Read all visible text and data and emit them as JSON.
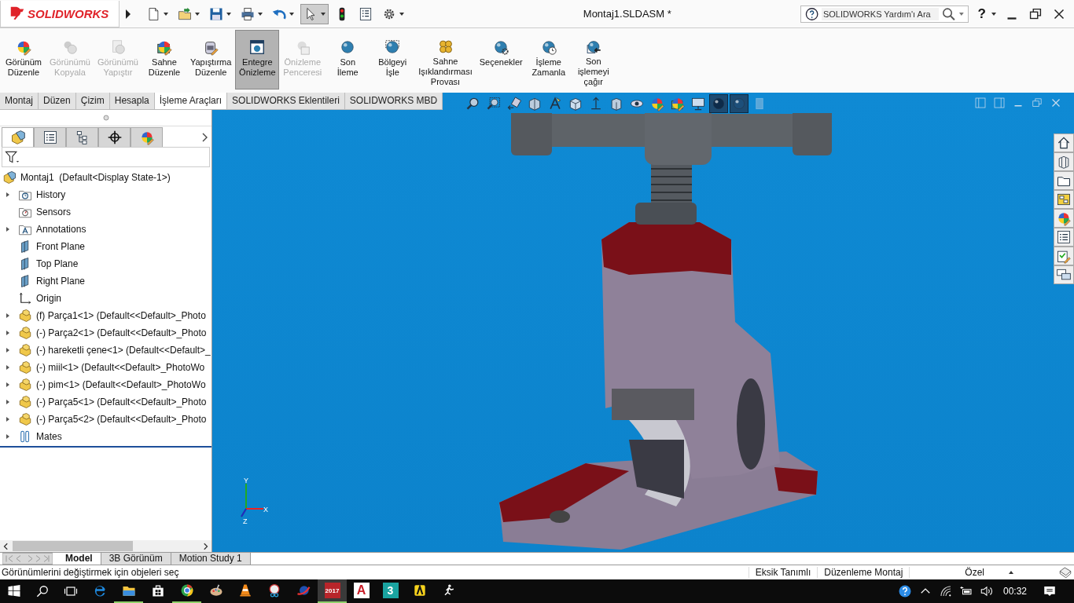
{
  "app": {
    "logo": "SOLIDWORKS",
    "title": "Montaj1.SLDASM *",
    "search_placeholder": "SOLIDWORKS Yardım'ı Ara",
    "help": "?"
  },
  "quick_access": [
    {
      "kind": "new",
      "dropdown": true,
      "selected": false
    },
    {
      "kind": "open",
      "dropdown": true,
      "selected": false
    },
    {
      "kind": "save",
      "dropdown": true,
      "selected": false
    },
    {
      "kind": "print",
      "dropdown": true,
      "selected": false
    },
    {
      "kind": "undo",
      "dropdown": true,
      "selected": false
    },
    {
      "kind": "select",
      "dropdown": true,
      "selected": true
    },
    {
      "kind": "rebuild",
      "dropdown": false,
      "selected": false
    },
    {
      "kind": "props",
      "dropdown": false,
      "selected": false
    },
    {
      "kind": "gear",
      "dropdown": true,
      "selected": false
    }
  ],
  "ribbon": [
    {
      "kind": "appearance",
      "label": "Görünüm\nDüzenle",
      "disabled": false,
      "selected": false
    },
    {
      "kind": "copy",
      "label": "Görünümü\nKopyala",
      "disabled": true,
      "selected": false
    },
    {
      "kind": "paste",
      "label": "Görünümü\nYapıştır",
      "disabled": true,
      "selected": false
    },
    {
      "kind": "scene",
      "label": "Sahne\nDüzenle",
      "disabled": false,
      "selected": false
    },
    {
      "kind": "decal",
      "label": "Yapıştırma\nDüzenle",
      "disabled": false,
      "selected": false
    },
    {
      "kind": "preview",
      "label": "Entegre\nÖnizleme",
      "disabled": false,
      "selected": true
    },
    {
      "kind": "window",
      "label": "Önizleme\nPenceresi",
      "disabled": true,
      "selected": false
    },
    {
      "kind": "render",
      "label": "Son\nİleme",
      "disabled": false,
      "selected": false
    },
    {
      "kind": "region",
      "label": "Bölgeyi\nİşle",
      "disabled": false,
      "selected": false
    },
    {
      "kind": "lights",
      "label": "Sahne\nIşıklandırması\nProvası",
      "disabled": false,
      "selected": false
    },
    {
      "kind": "options",
      "label": "Seçenekler",
      "disabled": false,
      "selected": false
    },
    {
      "kind": "schedule",
      "label": "İşleme\nZamanla",
      "disabled": false,
      "selected": false
    },
    {
      "kind": "recall",
      "label": "Son\nişlemeyi\nçağır",
      "disabled": false,
      "selected": false
    }
  ],
  "command_tabs": [
    {
      "label": "Montaj",
      "selected": false
    },
    {
      "label": "Düzen",
      "selected": false
    },
    {
      "label": "Çizim",
      "selected": false
    },
    {
      "label": "Hesapla",
      "selected": false
    },
    {
      "label": "İşleme Araçları",
      "selected": true
    },
    {
      "label": "SOLIDWORKS Eklentileri",
      "selected": false
    },
    {
      "label": "SOLIDWORKS MBD",
      "selected": false
    }
  ],
  "heads_up": [
    {
      "kind": "zoomfit",
      "selected": false
    },
    {
      "kind": "zoomarea",
      "selected": false
    },
    {
      "kind": "prev",
      "selected": false
    },
    {
      "kind": "section",
      "selected": false
    },
    {
      "kind": "annot",
      "selected": false
    },
    {
      "kind": "cube",
      "selected": false
    },
    {
      "kind": "updown",
      "selected": false
    },
    {
      "kind": "box",
      "selected": false
    },
    {
      "kind": "eye",
      "selected": false
    },
    {
      "kind": "appearance",
      "selected": false
    },
    {
      "kind": "scene",
      "selected": false
    },
    {
      "kind": "monitor",
      "selected": false
    },
    {
      "kind": "ball",
      "selected": true
    },
    {
      "kind": "ball2",
      "selected": true
    },
    {
      "kind": "faded",
      "selected": false
    }
  ],
  "viewport_controls": [
    {
      "kind": "panelleft"
    },
    {
      "kind": "panelright"
    },
    {
      "kind": "min"
    },
    {
      "kind": "restore"
    },
    {
      "kind": "close"
    }
  ],
  "task_pane": [
    {
      "kind": "home"
    },
    {
      "kind": "parts"
    },
    {
      "kind": "folder"
    },
    {
      "kind": "palette"
    },
    {
      "kind": "appearance"
    },
    {
      "kind": "list"
    },
    {
      "kind": "checker"
    },
    {
      "kind": "chat"
    }
  ],
  "panel_tabs": [
    {
      "kind": "tree",
      "selected": true
    },
    {
      "kind": "list",
      "selected": false
    },
    {
      "kind": "config",
      "selected": false
    },
    {
      "kind": "target",
      "selected": false
    },
    {
      "kind": "appearance",
      "selected": false
    }
  ],
  "tree": {
    "kind": "assembly",
    "label": "Montaj1  (Default<Display State-1>)",
    "children": [
      {
        "kind": "history",
        "label": "History",
        "expandable": true
      },
      {
        "kind": "sensors",
        "label": "Sensors",
        "expandable": false
      },
      {
        "kind": "annotations",
        "label": "Annotations",
        "expandable": true
      },
      {
        "kind": "plane",
        "label": "Front Plane",
        "expandable": false
      },
      {
        "kind": "plane",
        "label": "Top Plane",
        "expandable": false
      },
      {
        "kind": "plane",
        "label": "Right Plane",
        "expandable": false
      },
      {
        "kind": "origin",
        "label": "Origin",
        "expandable": false
      },
      {
        "kind": "part",
        "label": "(f) Parça1<1> (Default<<Default>_Photo",
        "expandable": true
      },
      {
        "kind": "part",
        "label": "(-) Parça2<1> (Default<<Default>_Photo",
        "expandable": true
      },
      {
        "kind": "part",
        "label": "(-) hareketli çene<1> (Default<<Default>_",
        "expandable": true
      },
      {
        "kind": "part",
        "label": "(-) miil<1> (Default<<Default>_PhotoWo",
        "expandable": true
      },
      {
        "kind": "part",
        "label": "(-) pim<1> (Default<<Default>_PhotoWo",
        "expandable": true
      },
      {
        "kind": "part",
        "label": "(-) Parça5<1> (Default<<Default>_Photo",
        "expandable": true
      },
      {
        "kind": "part",
        "label": "(-) Parça5<2> (Default<<Default>_Photo",
        "expandable": true
      },
      {
        "kind": "mates",
        "label": "Mates",
        "expandable": true
      }
    ]
  },
  "triad": {
    "x": "X",
    "y": "Y",
    "z": "Z"
  },
  "bottom_tabs": [
    {
      "label": "Model",
      "selected": true
    },
    {
      "label": "3B Görünüm",
      "selected": false
    },
    {
      "label": "Motion Study 1",
      "selected": false
    }
  ],
  "status": {
    "message": "Görünümlerini değiştirmek için objeleri seç",
    "fields": [
      "Eksik Tanımlı",
      "Düzenleme Montaj",
      "Özel"
    ]
  },
  "taskbar": {
    "apps": [
      {
        "kind": "edge",
        "running": false,
        "selected": false
      },
      {
        "kind": "explorer",
        "running": true,
        "selected": false
      },
      {
        "kind": "store",
        "running": false,
        "selected": false
      },
      {
        "kind": "chrome",
        "running": true,
        "selected": false
      },
      {
        "kind": "paint",
        "running": false,
        "selected": false
      },
      {
        "kind": "cone",
        "running": false,
        "selected": false
      },
      {
        "kind": "scissors",
        "running": false,
        "selected": false
      },
      {
        "kind": "globe",
        "running": false,
        "selected": false
      },
      {
        "kind": "sw",
        "label": "2017",
        "running": true,
        "selected": true
      },
      {
        "kind": "redapp",
        "label": "A",
        "running": false,
        "selected": false
      },
      {
        "kind": "tealapp",
        "label": "3",
        "running": false,
        "selected": false
      },
      {
        "kind": "yellowapp",
        "running": false,
        "selected": false
      },
      {
        "kind": "runner",
        "running": false,
        "selected": false
      }
    ],
    "time": "00:32"
  }
}
